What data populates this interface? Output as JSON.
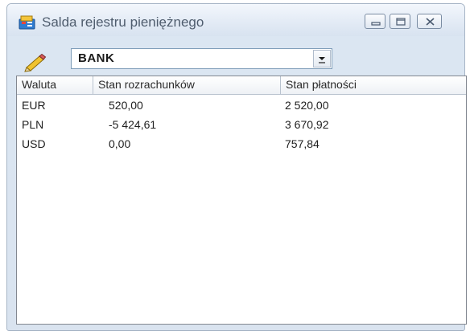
{
  "window": {
    "title": "Salda rejestru pieniężnego",
    "controls": [
      "minimize",
      "maximize",
      "close"
    ]
  },
  "toolbar": {
    "icon": "pencil-icon",
    "register_select": {
      "value": "BANK"
    }
  },
  "table": {
    "columns": [
      "Waluta",
      "Stan rozrachunków",
      "Stan płatności"
    ],
    "rows": [
      [
        "EUR",
        "520,00",
        "2 520,00"
      ],
      [
        "PLN",
        "-5 424,61",
        "3 670,92"
      ],
      [
        "USD",
        "0,00",
        "757,84"
      ]
    ]
  }
}
